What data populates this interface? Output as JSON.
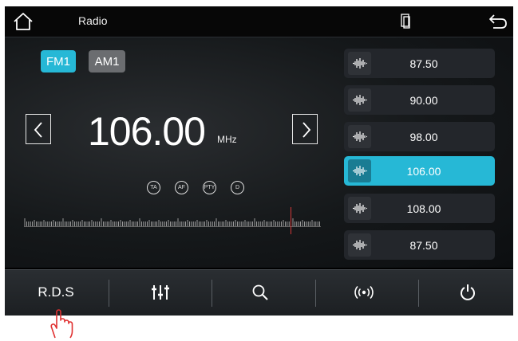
{
  "header": {
    "title": "Radio",
    "icons": [
      "home-icon",
      "phone-mirror-icon",
      "back-icon"
    ]
  },
  "bands": [
    {
      "label": "FM1",
      "active": true
    },
    {
      "label": "AM1",
      "active": false
    }
  ],
  "tuner": {
    "frequency": "106.00",
    "unit": "MHz"
  },
  "indicators": [
    "TA",
    "AF",
    "PTY",
    "D"
  ],
  "presets": [
    {
      "freq": "87.50",
      "active": false
    },
    {
      "freq": "90.00",
      "active": false
    },
    {
      "freq": "98.00",
      "active": false
    },
    {
      "freq": "106.00",
      "active": true
    },
    {
      "freq": "108.00",
      "active": false
    },
    {
      "freq": "87.50",
      "active": false
    }
  ],
  "bottom_bar": {
    "rds_label": "R.D.S",
    "icons": [
      "equalizer-icon",
      "search-icon",
      "broadcast-icon",
      "power-icon"
    ]
  },
  "colors": {
    "accent": "#26b8d6",
    "needle": "#d23838",
    "inactive_band": "#6b6d70",
    "hand_pointer": "#e03030"
  }
}
